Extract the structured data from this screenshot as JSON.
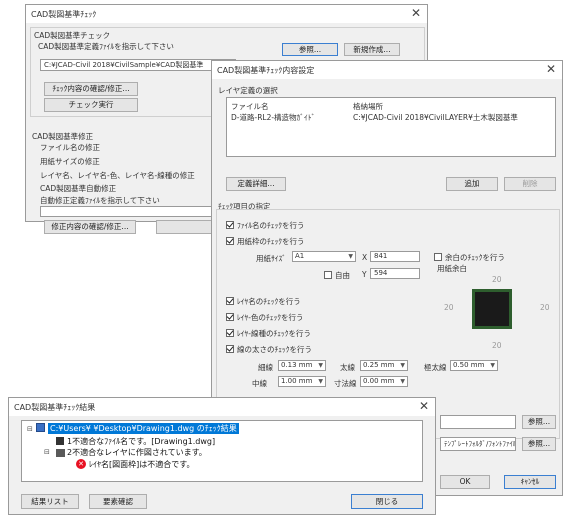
{
  "window1": {
    "title": "CAD製図基準ﾁｪｯｸ",
    "group1_title": "CAD製図基準チェック",
    "group1_prompt": "CAD製図基準定義ﾌｧｲﾙを指示して下さい",
    "ref_button": "参照...",
    "new_button": "新規作成...",
    "path_value": "C:¥JCAD-Civil 2018¥CivilSample¥CAD製図基準",
    "confirm_button": "ﾁｪｯｸ内容の確認/修正...",
    "run_button": "チェック実行",
    "group2_title": "CAD製図基準修正",
    "filename_fix": "ファイル名の修正",
    "paper_fix": "用紙サイズの修正",
    "layer_fix": "レイヤ名、レイヤ名-色、レイヤ名-線種の修正",
    "auto_fix_title": "CAD製図基準自動修正",
    "auto_fix_prompt": "自動修正定義ﾌｧｲﾙを指示して下さい",
    "fix_confirm_button": "修正内容の確認/修正..."
  },
  "window2": {
    "title": "CAD製図基準ﾁｪｯｸ内容設定",
    "group_layer": "レイヤ定義の選択",
    "col_file": "ファイル名",
    "col_loc": "格納場所",
    "row_file": "D-道路-RL2-構造物ｶﾞｲﾄﾞ",
    "row_loc": "C:¥JCAD-Civil 2018¥CivilLAYER¥土木製図基準",
    "detail_button": "定義詳細...",
    "add_button": "追加",
    "delete_button": "削除",
    "group_check": "ﾁｪｯｸ項目の指定",
    "cb_filename": "ﾌｧｲﾙ名のﾁｪｯｸを行う",
    "cb_paper": "用紙枠のﾁｪｯｸを行う",
    "paper_size_label": "用紙ｻｲｽﾞ",
    "paper_size_value": "A1",
    "x_label": "X",
    "x_value": "841",
    "y_label": "Y",
    "y_value": "594",
    "free_label": "自由",
    "margin_cb": "余白のﾁｪｯｸを行う",
    "margin_label": "用紙余白",
    "margin_top": "20",
    "margin_left": "20",
    "margin_right": "20",
    "margin_bottom": "20",
    "cb_layer": "ﾚｲﾔ名のﾁｪｯｸを行う",
    "cb_layer_color": "ﾚｲﾔ-色のﾁｪｯｸを行う",
    "cb_layer_linetype": "ﾚｲﾔ-線種のﾁｪｯｸを行う",
    "cb_linewidth": "線の太さのﾁｪｯｸを行う",
    "thin_label": "細線",
    "thin_value": "0.13 mm",
    "thick_label": "太線",
    "thick_value": "0.25 mm",
    "very_thick_label": "極太線",
    "very_thick_value": "0.50 mm",
    "middle_label": "中線",
    "middle_value": "1.00 mm",
    "dim_label": "寸法線",
    "dim_value": "0.00 mm",
    "ref2_button": "参照...",
    "fontpath_value": "ﾃﾝﾌﾟﾚｰﾄﾌｫﾙﾀﾞ/ﾌｫﾝﾄﾌｧｲﾙ(?)",
    "ref3_button": "参照...",
    "ok_button": "OK",
    "cancel_button": "ｷｬﾝｾﾙ"
  },
  "window3": {
    "title": "CAD製図基準ﾁｪｯｸ結果",
    "root_label": "C:¥Users¥        ¥Desktop¥Drawing1.dwg のﾁｪｯｸ結果",
    "item1": "1不適合なﾌｧｲﾙ名です。[Drawing1.dwg]",
    "item2": "2不適合なレイヤに作図されています。",
    "item3": "ﾚｲﾔ名[図面枠]は不適合です。",
    "result_list_button": "結果リスト",
    "element_confirm_button": "要素確認",
    "close_button": "閉じる"
  },
  "colors": {
    "accent": "#0078d7",
    "error": "#e81123"
  }
}
